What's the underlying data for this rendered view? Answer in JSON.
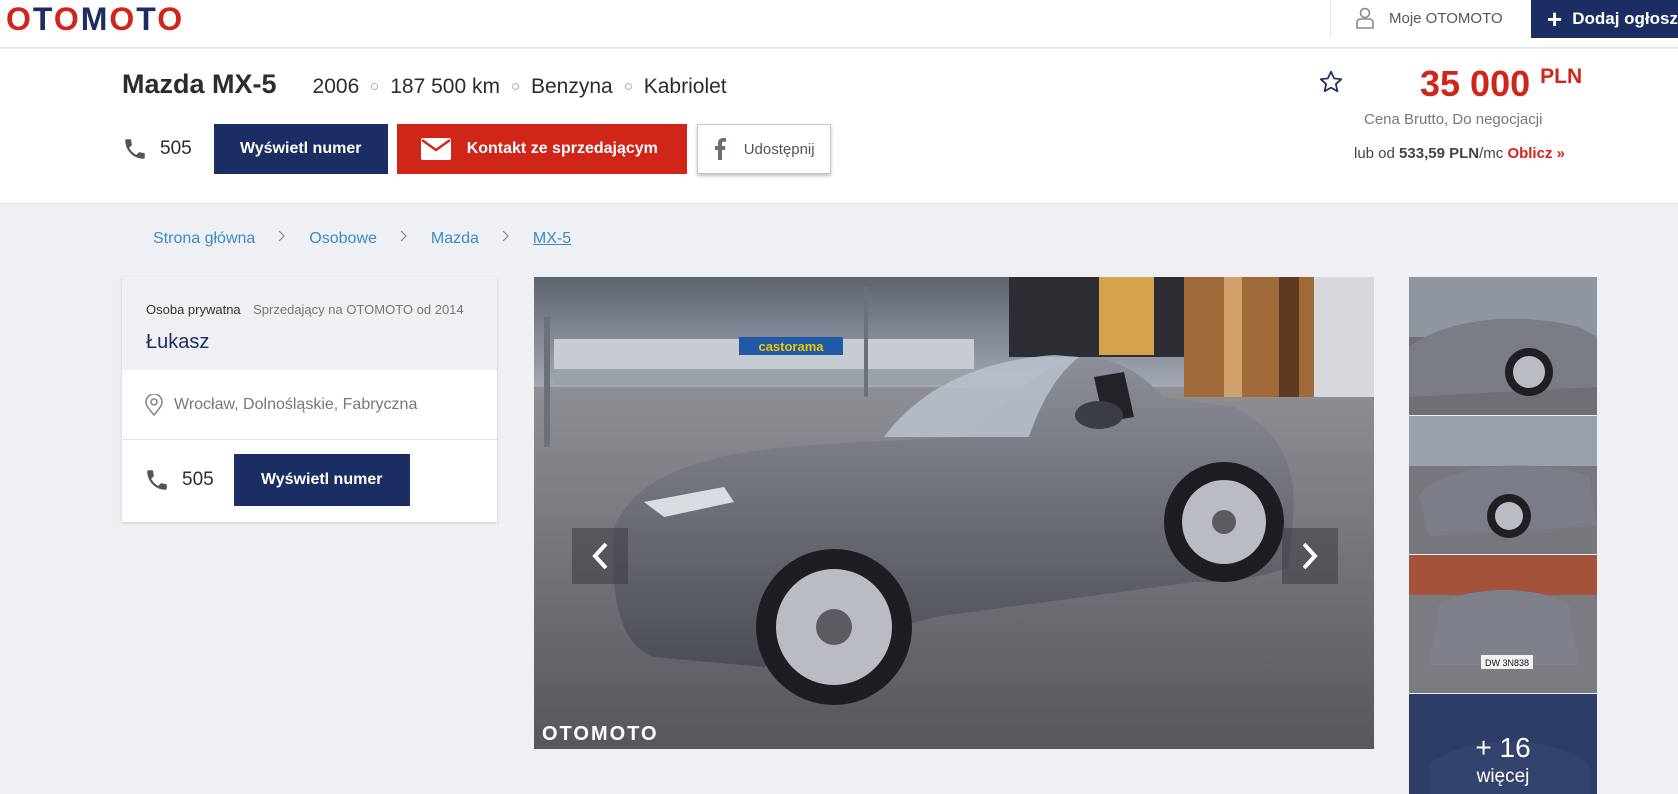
{
  "brand": {
    "logo_text": "OTOMOTO",
    "accent": "#d0261a",
    "navy": "#1b2d63",
    "link": "#3a8bc8"
  },
  "topnav": {
    "account_label": "Moje OTOMOTO",
    "add_label": "Dodaj ogłosz"
  },
  "listing": {
    "title": "Mazda MX-5",
    "params": [
      "2006",
      "187 500 km",
      "Benzyna",
      "Kabriolet"
    ],
    "phone_prefix": "505",
    "show_number_label": "Wyświetl numer",
    "contact_label": "Kontakt ze sprzedającym",
    "share_label": "Udostępnij",
    "price_value": "35 000",
    "price_currency": "PLN",
    "price_note": "Cena Brutto, Do negocjacji",
    "finance_prefix": "lub od ",
    "finance_amount": "533,59 PLN",
    "finance_suffix": "/mc ",
    "finance_link": "Oblicz »"
  },
  "breadcrumb": [
    "Strona główna",
    "Osobowe",
    "Mazda",
    "MX-5"
  ],
  "seller": {
    "type": "Osoba prywatna",
    "since": "Sprzedający na OTOMOTO od 2014",
    "name": "Łukasz",
    "location": "Wrocław, Dolnośląskie, Fabryczna",
    "phone_prefix": "505",
    "show_number_label": "Wyświetl numer"
  },
  "gallery": {
    "watermark": "OTOMOTO",
    "store_sign": "castorama",
    "more_count": "+ 16",
    "more_label": "więcej",
    "plate_text": "DW 3N838"
  }
}
